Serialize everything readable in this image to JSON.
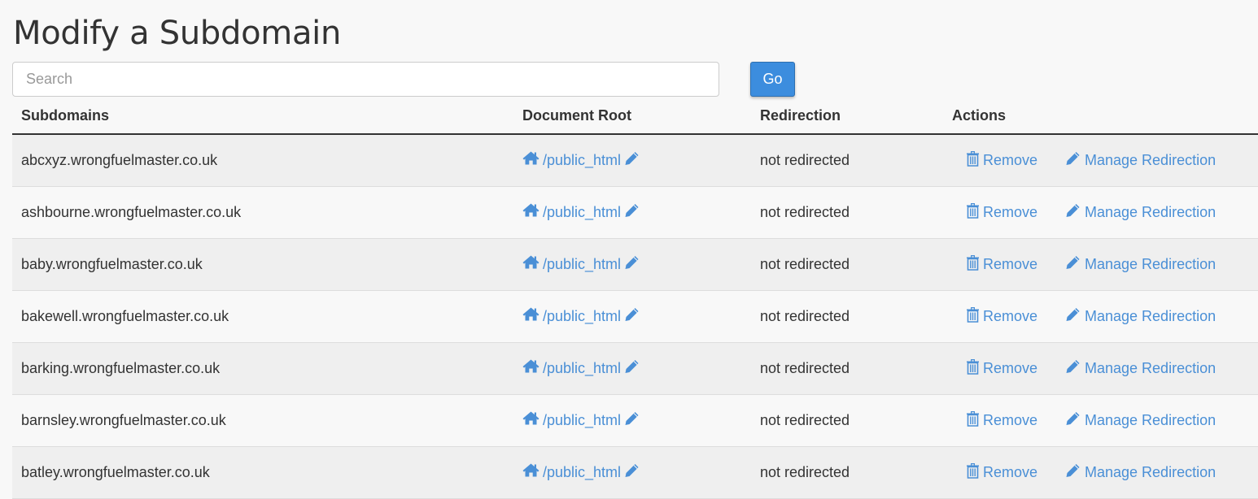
{
  "page": {
    "title": "Modify a Subdomain"
  },
  "search": {
    "placeholder": "Search",
    "value": "",
    "go_label": "Go"
  },
  "table": {
    "headers": {
      "subdomains": "Subdomains",
      "document_root": "Document Root",
      "redirection": "Redirection",
      "actions": "Actions"
    },
    "rows": [
      {
        "subdomain": "abcxyz.wrongfuelmaster.co.uk",
        "document_root": "/public_html",
        "redirection": "not redirected",
        "remove": "Remove",
        "manage": "Manage Redirection"
      },
      {
        "subdomain": "ashbourne.wrongfuelmaster.co.uk",
        "document_root": "/public_html",
        "redirection": "not redirected",
        "remove": "Remove",
        "manage": "Manage Redirection"
      },
      {
        "subdomain": "baby.wrongfuelmaster.co.uk",
        "document_root": "/public_html",
        "redirection": "not redirected",
        "remove": "Remove",
        "manage": "Manage Redirection"
      },
      {
        "subdomain": "bakewell.wrongfuelmaster.co.uk",
        "document_root": "/public_html",
        "redirection": "not redirected",
        "remove": "Remove",
        "manage": "Manage Redirection"
      },
      {
        "subdomain": "barking.wrongfuelmaster.co.uk",
        "document_root": "/public_html",
        "redirection": "not redirected",
        "remove": "Remove",
        "manage": "Manage Redirection"
      },
      {
        "subdomain": "barnsley.wrongfuelmaster.co.uk",
        "document_root": "/public_html",
        "redirection": "not redirected",
        "remove": "Remove",
        "manage": "Manage Redirection"
      },
      {
        "subdomain": "batley.wrongfuelmaster.co.uk",
        "document_root": "/public_html",
        "redirection": "not redirected",
        "remove": "Remove",
        "manage": "Manage Redirection"
      }
    ]
  },
  "icons": {
    "document_root": "home-icon",
    "edit": "pencil-icon",
    "remove": "trash-icon",
    "manage": "pencil-icon"
  },
  "colors": {
    "link": "#4a8fd6",
    "button": "#3c8dde",
    "background": "#f8f8f8",
    "row_alt": "#efefef"
  }
}
